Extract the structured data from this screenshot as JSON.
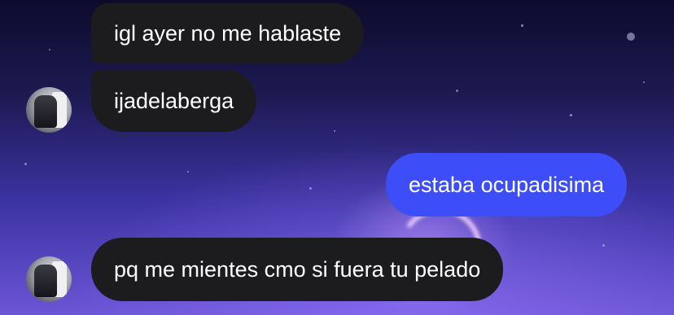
{
  "colors": {
    "incoming_bubble": "#1c1c1f",
    "outgoing_bubble": "#3d4df7",
    "text": "#ffffff"
  },
  "messages": [
    {
      "direction": "incoming",
      "text": "igl ayer no me hablaste",
      "avatar": false
    },
    {
      "direction": "incoming",
      "text": "ijadelaberga",
      "avatar": true
    },
    {
      "direction": "outgoing",
      "text": "estaba ocupadisima"
    },
    {
      "direction": "incoming",
      "text": "pq me mientes cmo si fuera tu pelado",
      "avatar": true
    }
  ],
  "avatar_icon": "contact-avatar"
}
